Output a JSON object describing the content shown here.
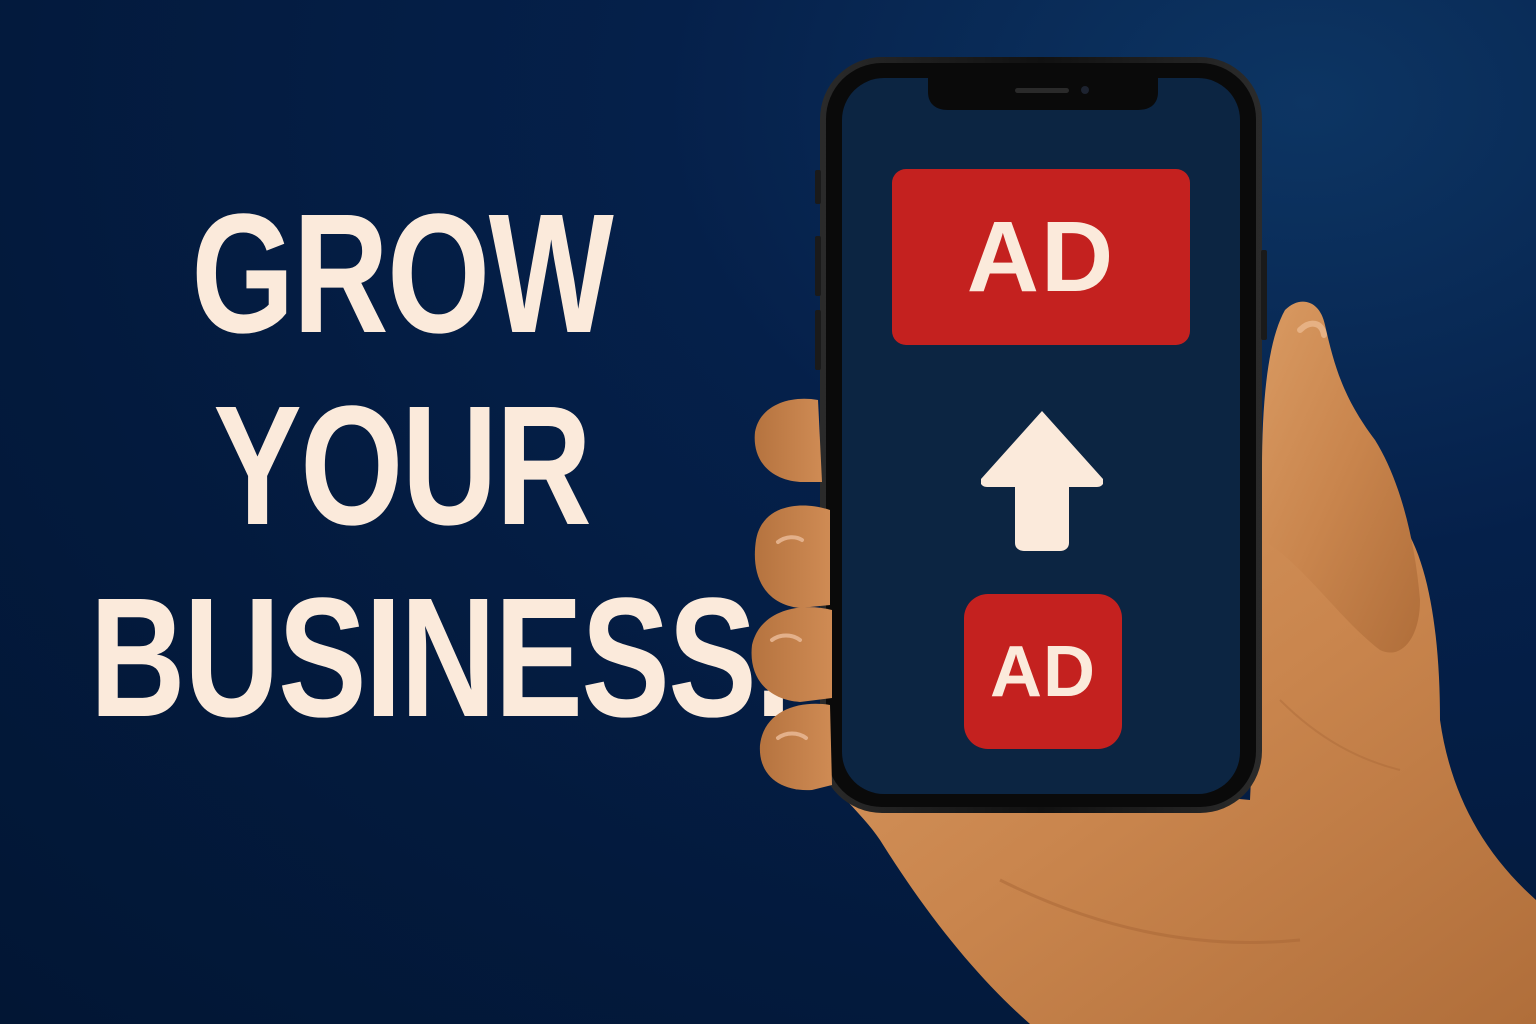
{
  "headline": {
    "lines": [
      "GROW",
      "YOUR",
      "BUSINESS."
    ]
  },
  "phone": {
    "top_ad_label": "AD",
    "bottom_ad_label": "AD",
    "arrow_icon": "arrow-up-icon"
  },
  "colors": {
    "background": "#031a3d",
    "headline_text": "#fbeadb",
    "ad_red": "#c4211f",
    "screen": "#0c2542"
  }
}
